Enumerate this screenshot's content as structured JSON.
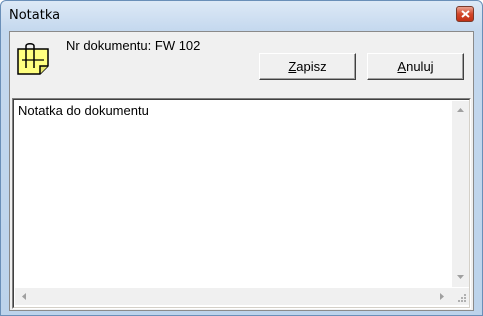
{
  "window": {
    "title": "Notatka"
  },
  "header": {
    "document_label": "Nr dokumentu: FW 102",
    "icon": "document-note-icon"
  },
  "buttons": {
    "save_label_mnemonic": "Z",
    "save_label_rest": "apisz",
    "cancel_label_mnemonic": "A",
    "cancel_label_rest": "nuluj"
  },
  "memo": {
    "value": "Notatka do dokumentu"
  },
  "colors": {
    "icon_fill": "#ffff80",
    "icon_stroke": "#000000",
    "close_button": "#c13015"
  }
}
